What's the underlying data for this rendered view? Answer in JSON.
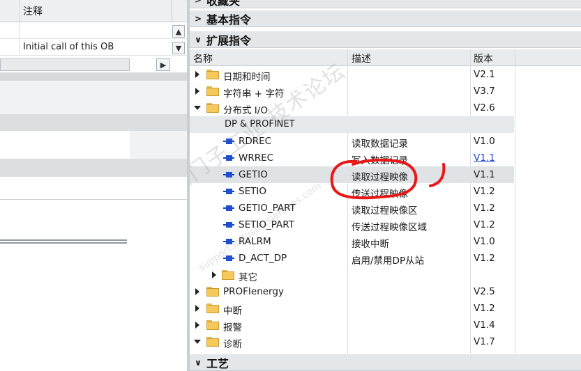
{
  "left_panel": {
    "header_col": "注释",
    "row_comment": "Initial call of this OB"
  },
  "right_panel": {
    "sections": {
      "favorites": "收藏夹",
      "basic": "基本指令",
      "extended": "扩展指令",
      "tech": "工艺"
    },
    "columns": {
      "name": "名称",
      "desc": "描述",
      "version": "版本"
    },
    "rows": [
      {
        "name": "日期和时间",
        "desc": "",
        "version": "V2.1"
      },
      {
        "name": "字符串 + 字符",
        "desc": "",
        "version": "V3.7"
      },
      {
        "name": "分布式 I/O",
        "desc": "",
        "version": "V2.6"
      },
      {
        "name": "DP & PROFINET",
        "desc": "",
        "version": ""
      },
      {
        "name": "RDREC",
        "desc": "读取数据记录",
        "version": "V1.0"
      },
      {
        "name": "WRREC",
        "desc": "写入数据记录",
        "version": "V1.1"
      },
      {
        "name": "GETIO",
        "desc": "读取过程映像",
        "version": "V1.1"
      },
      {
        "name": "SETIO",
        "desc": "传送过程映像",
        "version": "V1.2"
      },
      {
        "name": "GETIO_PART",
        "desc": "读取过程映像区",
        "version": "V1.2"
      },
      {
        "name": "SETIO_PART",
        "desc": "传送过程映像区域",
        "version": "V1.2"
      },
      {
        "name": "RALRM",
        "desc": "接收中断",
        "version": "V1.0"
      },
      {
        "name": "D_ACT_DP",
        "desc": "启用/禁用DP从站",
        "version": "V1.2"
      },
      {
        "name": "其它",
        "desc": "",
        "version": ""
      },
      {
        "name": "PROFIenergy",
        "desc": "",
        "version": "V2.5"
      },
      {
        "name": "中断",
        "desc": "",
        "version": "V1.2"
      },
      {
        "name": "报警",
        "desc": "",
        "version": "V1.4"
      },
      {
        "name": "诊断",
        "desc": "",
        "version": "V1.7"
      }
    ]
  },
  "watermark": "西门子工业 技术论坛",
  "watermark_url": "support.industry.siemens.com",
  "colors": {
    "annotation": "#e81818",
    "section_bg": "#e3e7ea",
    "selected_row": "#dfe3e6"
  }
}
